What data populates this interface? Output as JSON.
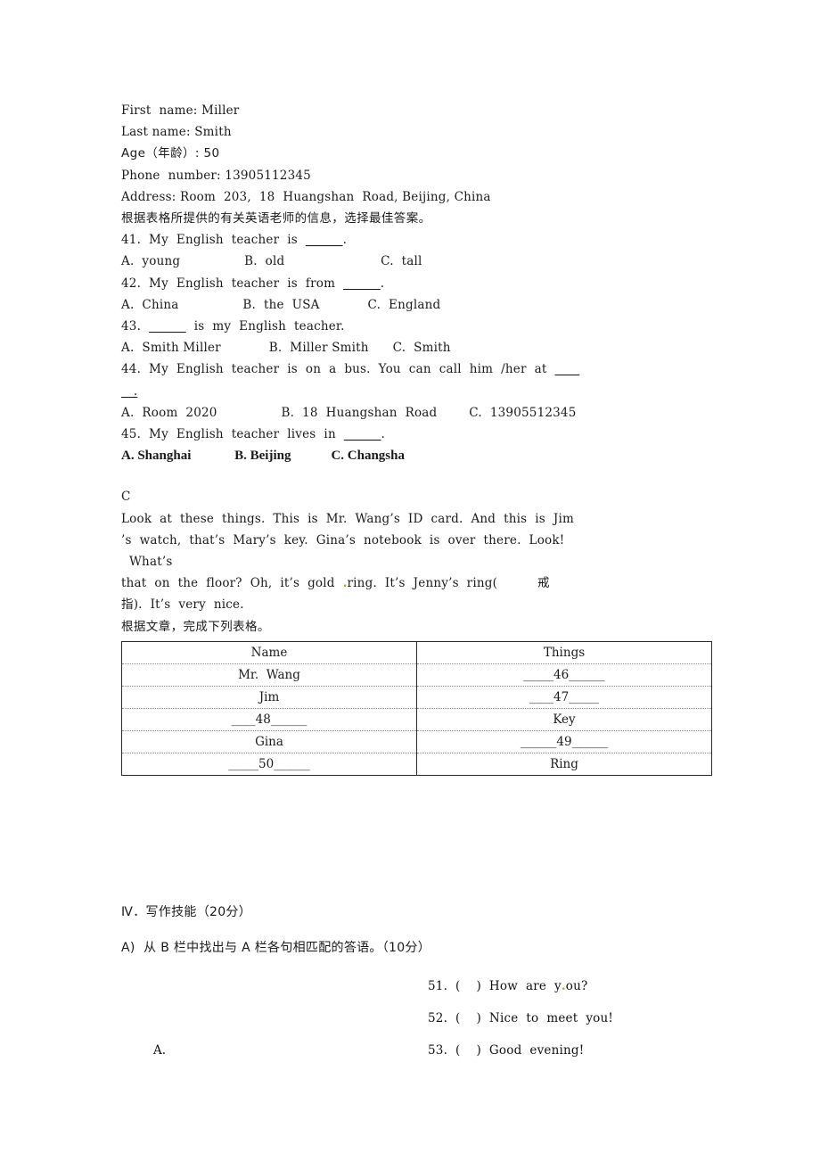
{
  "document": {
    "info_card": {
      "lines": [
        "First  name: Miller",
        "Last name: Smith",
        "Age（年龄）: 50",
        "Phone  number: 13905112345",
        "Address: Room  203,  18  Huangshan  Road, Beijing, China"
      ]
    },
    "instruction_b": "根据表格所提供的有关英语老师的信息，选择最佳答案。",
    "questions": [
      {
        "number": "41.",
        "stem_before": "41.  My  English  teacher  is  ",
        "stem_blank": "______",
        "stem_after": ".",
        "options_line": "A.  young                B.  old                        C.  tall"
      },
      {
        "number": "42.",
        "stem_before": "42.  My  English  teacher  is  from  ",
        "stem_blank": "______",
        "stem_after": ".",
        "options_line": "A.  China                B.  the  USA            C.  England"
      },
      {
        "number": "43.",
        "stem_before": "43.  ",
        "stem_blank": "______",
        "stem_after": "  is  my  English  teacher.",
        "options_line": "A.  Smith Miller            B.  Miller Smith      C.  Smith"
      },
      {
        "number": "44.",
        "stem_before": "44.  My  English  teacher  is  on  a  bus.  You  can  call  him  /her  at  ",
        "stem_blank": "____",
        "stem_after": "",
        "stem_wrap_line": "__.",
        "options_line": "A.  Room  2020                B.  18  Huangshan  Road        C.  13905512345"
      },
      {
        "number": "45.",
        "stem_before": "45.  My  English  teacher  lives  in  ",
        "stem_blank": "______",
        "stem_after": ".",
        "options_line": "A. Shanghai             B. Beijing            C. Changsha"
      }
    ],
    "passage": {
      "label": "C",
      "line1": "Look  at  these  things.  This  is  Mr.  Wang’s  ID  card.  And  this  is  Jim",
      "line2": "’s  watch,  that’s  Mary’s  key.  Gina’s  notebook  is  over  there.  Look!",
      "line3": "  What’s",
      "line4_pre": "that  on  the  floor?  Oh,  it’s  gold  ",
      "line4_mark": ".",
      "line4_post": "ring.  It’s  Jenny’s  ring(          戒",
      "line5": "指).  It’s  very  nice.",
      "instruction": "根据文章，完成下列表格。"
    },
    "table": {
      "headers": [
        "Name",
        "Things"
      ],
      "rows": [
        [
          "Mr.  Wang",
          "_____46______"
        ],
        [
          "Jim",
          "____47_____"
        ],
        [
          "____48______",
          "Key"
        ],
        [
          "Gina",
          "______49______"
        ],
        [
          "_____50______",
          "Ring"
        ]
      ]
    },
    "writing_section": {
      "heading": "Ⅳ．写作技能（20分）",
      "subheading": "A)  从 B 栏中找出与 A 栏各句相匹配的答语。（10分）",
      "left_column": [
        {
          "label": ""
        },
        {
          "label": ""
        },
        {
          "label": "A."
        }
      ],
      "right_column": [
        {
          "text_pre": "51.  (    )  How  are  y",
          "mark": ".",
          "text_post": "ou?"
        },
        {
          "text_pre": "52.  (    )  Nice  to  meet  you!",
          "mark": "",
          "text_post": ""
        },
        {
          "text_pre": "53.  (    )  Good  evening!",
          "mark": "",
          "text_post": ""
        }
      ]
    },
    "colors": {
      "text": "#1a1a1a",
      "table_border": "#2b2b2b",
      "table_inner_border": "#8a8a8a",
      "mark": "#b3a60a"
    }
  }
}
